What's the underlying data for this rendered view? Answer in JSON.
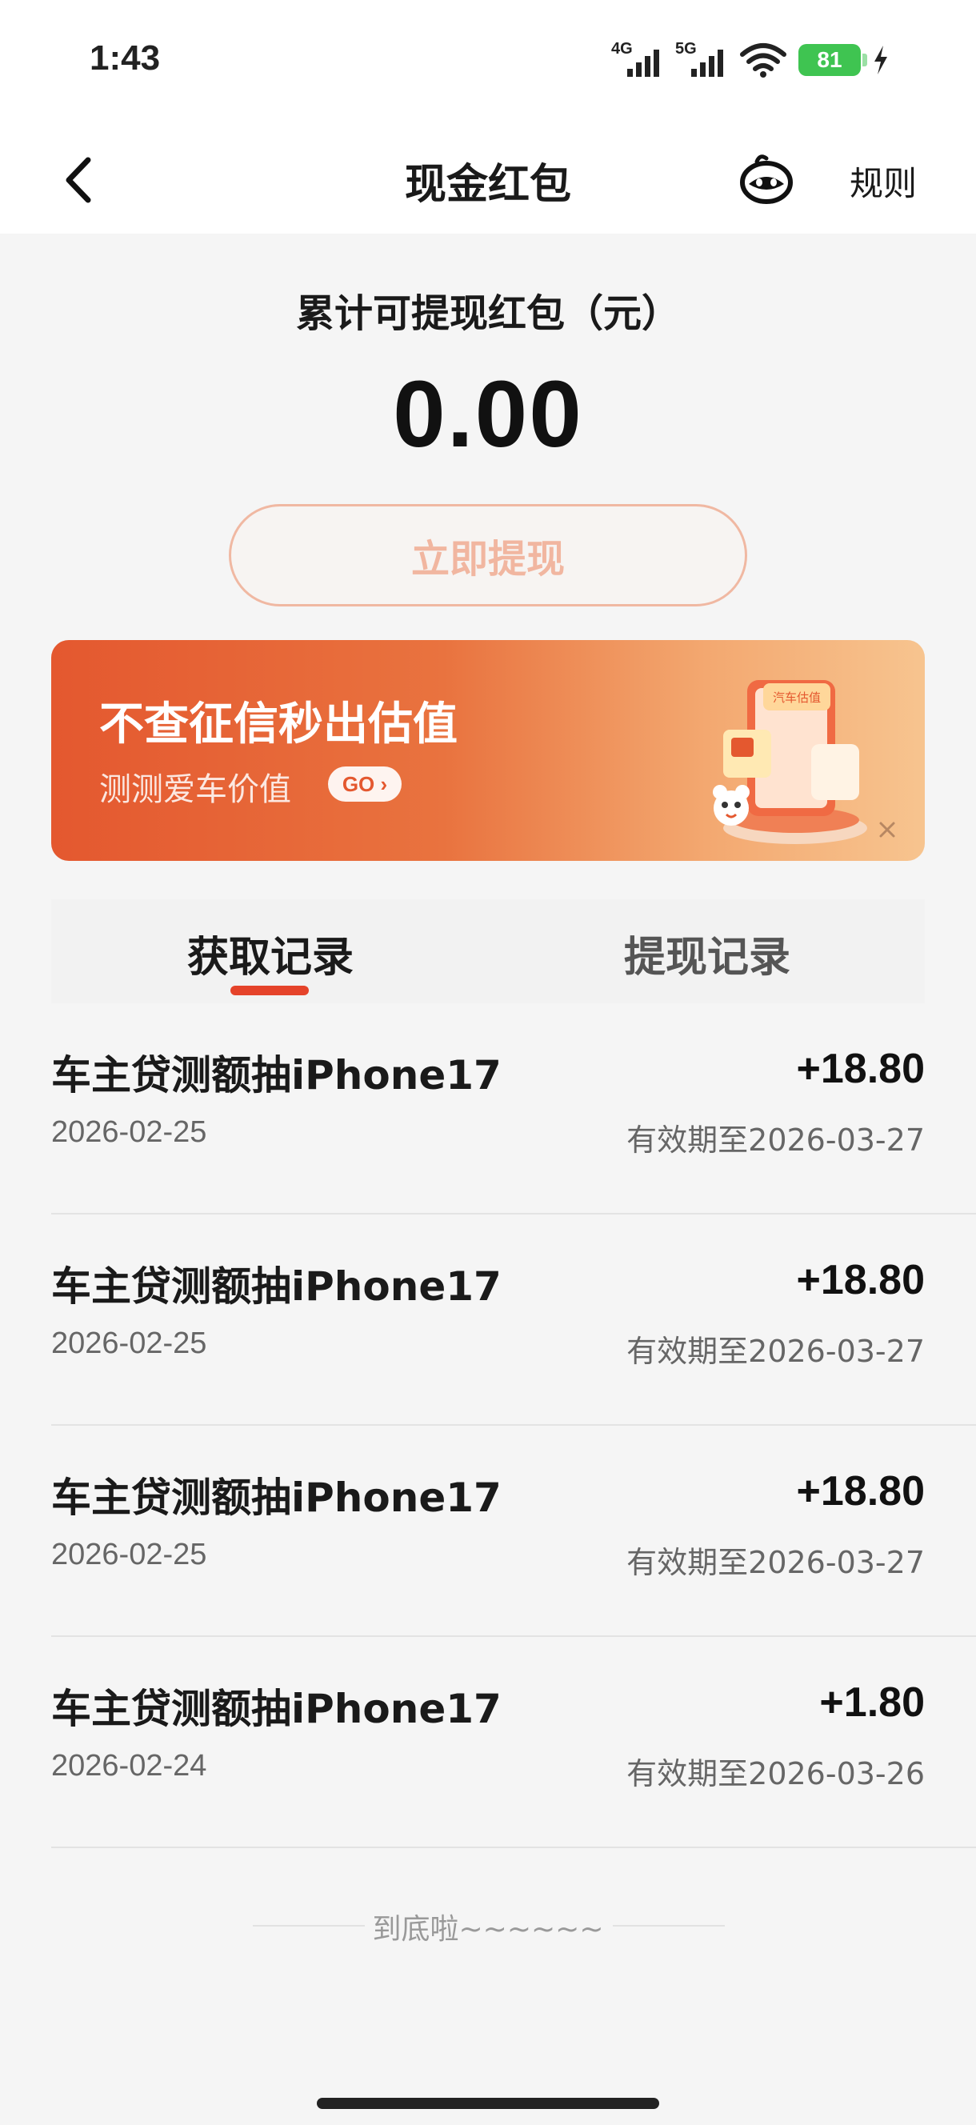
{
  "status_bar": {
    "time": "1:43",
    "network_1": "4G",
    "network_2": "5G",
    "battery": "81"
  },
  "nav": {
    "title": "现金红包",
    "rules_label": "规则",
    "icons": [
      "back-icon",
      "robot-service-icon"
    ]
  },
  "summary": {
    "label": "累计可提现红包（元）",
    "amount": "0.00",
    "withdraw_button": "立即提现"
  },
  "banner": {
    "title": "不查征信秒出估值",
    "subtitle": "测测爱车价值",
    "go_label": "GO",
    "illustration_text": "汽车估值"
  },
  "tabs": [
    {
      "label": "获取记录",
      "active": true
    },
    {
      "label": "提现记录",
      "active": false
    }
  ],
  "records": [
    {
      "title": "车主贷测额抽iPhone17",
      "date": "2026-02-25",
      "amount": "+18.80",
      "expiry": "有效期至2026-03-27"
    },
    {
      "title": "车主贷测额抽iPhone17",
      "date": "2026-02-25",
      "amount": "+18.80",
      "expiry": "有效期至2026-03-27"
    },
    {
      "title": "车主贷测额抽iPhone17",
      "date": "2026-02-25",
      "amount": "+18.80",
      "expiry": "有效期至2026-03-27"
    },
    {
      "title": "车主贷测额抽iPhone17",
      "date": "2026-02-24",
      "amount": "+1.80",
      "expiry": "有效期至2026-03-26"
    }
  ],
  "end_text": "到底啦~~~~~~",
  "colors": {
    "accent": "#e5432a",
    "banner_start": "#e4582f",
    "banner_end": "#f7c48f",
    "button_border": "#f0b8a2",
    "battery_green": "#3fc451"
  }
}
